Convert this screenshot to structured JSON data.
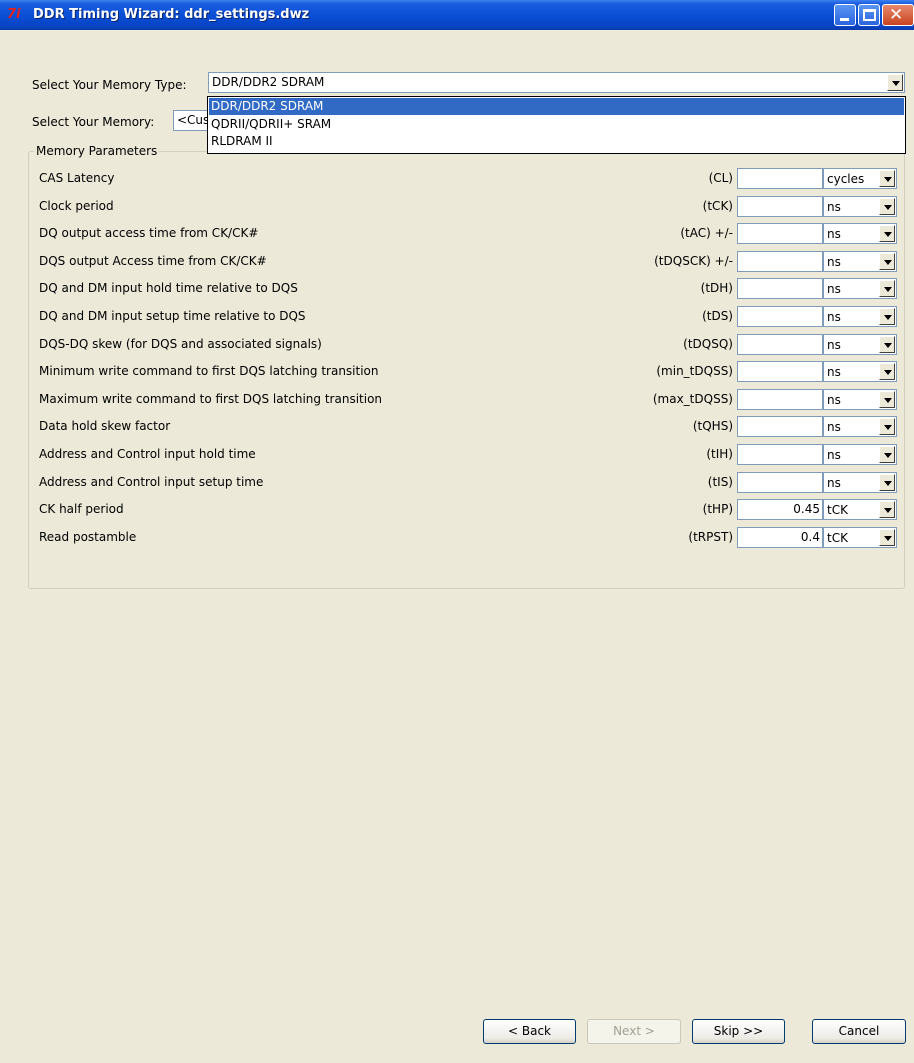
{
  "window": {
    "app_icon": "7i",
    "title": "DDR Timing Wizard: ddr_settings.dwz",
    "minimize_icon": "minimize-icon",
    "maximize_icon": "maximize-icon",
    "close_icon": "close-icon",
    "close_glyph": "✕"
  },
  "memory_type": {
    "label": "Select Your Memory Type:",
    "value": "DDR/DDR2 SDRAM",
    "options": [
      "DDR/DDR2 SDRAM",
      "QDRII/QDRII+ SRAM",
      "RLDRAM II"
    ],
    "selected_index": 0
  },
  "memory": {
    "label": "Select Your Memory:",
    "value": "<Cus"
  },
  "parameters": {
    "group_title": "Memory Parameters",
    "rows": [
      {
        "label": "CAS Latency",
        "symbol": "(CL)",
        "value": "",
        "unit": "cycles"
      },
      {
        "label": "Clock period",
        "symbol": "(tCK)",
        "value": "",
        "unit": "ns"
      },
      {
        "label": "DQ output access time from CK/CK#",
        "symbol": "(tAC) +/-",
        "value": "",
        "unit": "ns"
      },
      {
        "label": "DQS output Access time from CK/CK#",
        "symbol": "(tDQSCK) +/-",
        "value": "",
        "unit": "ns"
      },
      {
        "label": "DQ and DM input hold time relative to DQS",
        "symbol": "(tDH)",
        "value": "",
        "unit": "ns"
      },
      {
        "label": "DQ and DM input setup time relative to DQS",
        "symbol": "(tDS)",
        "value": "",
        "unit": "ns"
      },
      {
        "label": "DQS-DQ skew (for DQS and associated signals)",
        "symbol": "(tDQSQ)",
        "value": "",
        "unit": "ns"
      },
      {
        "label": "Minimum write command to first DQS latching transition",
        "symbol": "(min_tDQSS)",
        "value": "",
        "unit": "ns"
      },
      {
        "label": "Maximum write command to first DQS latching transition",
        "symbol": "(max_tDQSS)",
        "value": "",
        "unit": "ns"
      },
      {
        "label": "Data hold skew factor",
        "symbol": "(tQHS)",
        "value": "",
        "unit": "ns"
      },
      {
        "label": "Address and Control input hold time",
        "symbol": "(tIH)",
        "value": "",
        "unit": "ns"
      },
      {
        "label": "Address and Control input setup time",
        "symbol": "(tIS)",
        "value": "",
        "unit": "ns"
      },
      {
        "label": "CK half period",
        "symbol": "(tHP)",
        "value": "0.45",
        "unit": "tCK"
      },
      {
        "label": "Read postamble",
        "symbol": "(tRPST)",
        "value": "0.4",
        "unit": "tCK"
      }
    ]
  },
  "buttons": {
    "back": "< Back",
    "next": "Next >",
    "skip": "Skip >>",
    "cancel": "Cancel"
  }
}
